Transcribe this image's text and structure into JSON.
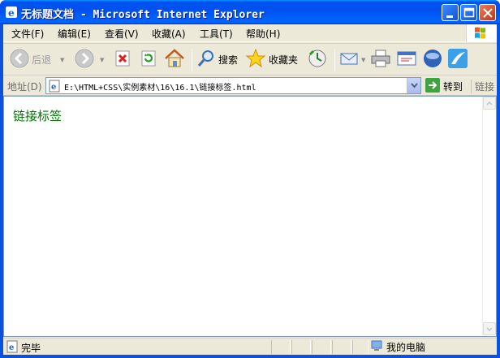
{
  "window": {
    "title": "无标题文档 - Microsoft Internet Explorer"
  },
  "menu": {
    "items": [
      {
        "label": "文件(F)"
      },
      {
        "label": "编辑(E)"
      },
      {
        "label": "查看(V)"
      },
      {
        "label": "收藏(A)"
      },
      {
        "label": "工具(T)"
      },
      {
        "label": "帮助(H)"
      }
    ]
  },
  "toolbar": {
    "back_label": "后退",
    "search_label": "搜索",
    "favorites_label": "收藏夹"
  },
  "address": {
    "label": "地址(D)",
    "value": "E:\\HTML+CSS\\实例素材\\16\\16.1\\链接标签.html",
    "go_label": "转到",
    "links_label": "链接"
  },
  "content": {
    "link_text": "链接标签",
    "link_color": "#007700"
  },
  "status": {
    "text": "完毕",
    "zone": "我的电脑"
  },
  "colors": {
    "titlebar": "#0050ee",
    "frame": "#ece9d8"
  }
}
